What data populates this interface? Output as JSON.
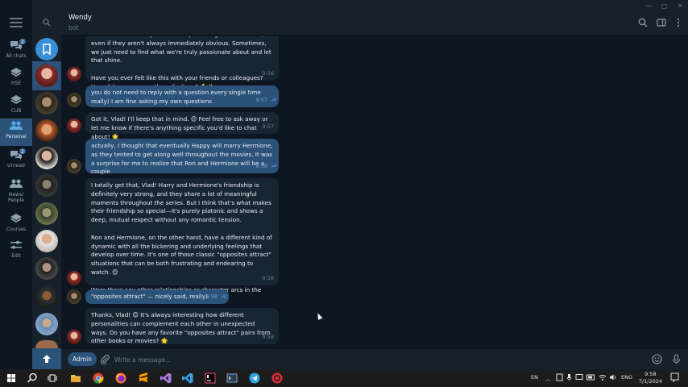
{
  "window": {
    "minimize": "—",
    "maximize": "▢",
    "close": "✕"
  },
  "folders": [
    {
      "label": "All chats",
      "badge": "2",
      "icon": "chat-bubbles-icon"
    },
    {
      "label": "HSE",
      "icon": "layers-icon"
    },
    {
      "label": "CUB",
      "icon": "layers-icon"
    },
    {
      "label": "Personal",
      "icon": "people-icon",
      "active": true
    },
    {
      "label": "Unread",
      "badge": "2",
      "icon": "chat-bubbles-icon"
    },
    {
      "label": "News/\nPeople",
      "icon": "people-icon"
    },
    {
      "label": "Courses",
      "icon": "layers-icon"
    },
    {
      "label": "Edit",
      "icon": "sliders-icon"
    }
  ],
  "header": {
    "name": "Wendy",
    "status": "bot"
  },
  "messages": [
    {
      "dir": "in",
      "text": "remember that everyone has unique strengths and talents, even if they aren't always immediately obvious. Sometimes, we just need to find what we're truly passionate about and let that shine.\n\nHave you ever felt like this with your friends or colleagues? How did you manage those feelings? 💪✨",
      "time": "9:56"
    },
    {
      "dir": "out",
      "text": "you do not need to reply with a question every single time really) I am fine asking my own questions",
      "time": "9:57"
    },
    {
      "dir": "in",
      "text": "Got it, Vlad! I'll keep that in mind. 😊 Feel free to ask away or let me know if there's anything specific you'd like to chat about! 🌟",
      "time": "9:57"
    },
    {
      "dir": "out",
      "text": "actually, I thought that eventually Happy will marry Hermione, as they tented to get along well throughout the movies. It was a surprise for me to realize that Ron and Hermione will be a couple",
      "time": "9:58"
    },
    {
      "dir": "in",
      "text": "I totally get that, Vlad! Harry and Hermione's friendship is definitely very strong, and they share a lot of meaningful moments throughout the series. But I think that's what makes their friendship so special—it's purely platonic and shows a deep, mutual respect without any romantic tension.\n\nRon and Hermione, on the other hand, have a different kind of dynamic with all the bickering and underlying feelings that develop over time. It's one of those classic \"opposites attract\" situations that can be both frustrating and endearing to watch. 😊\n\nWere there any other relationships or character arcs in the series that surprised or intrigued you? 🌟",
      "time": "9:58"
    },
    {
      "dir": "out",
      "text": "\"opposites attract\" — nicely said, really)",
      "time": "9:58"
    },
    {
      "dir": "in",
      "text": "Thanks, Vlad! 😊 It's always interesting how different personalities can complement each other in unexpected ways. Do you have any favorite \"opposites attract\" pairs from other books or movies? 🌟",
      "time": "9:58"
    }
  ],
  "composer": {
    "admin_label": "Admin",
    "placeholder": "Write a message..."
  },
  "taskbar": {
    "lang": "EN",
    "keyboard": "ENG",
    "time": "9:58",
    "date": "7/1/2024",
    "apps": [
      "windows-start-icon",
      "search-icon",
      "task-view-icon",
      "file-explorer-icon",
      "chrome-icon",
      "firefox-icon",
      "sublime-icon",
      "visual-studio-icon",
      "vscode-icon",
      "jetbrains-icon",
      "terminal-icon",
      "telegram-icon",
      "opera-icon"
    ]
  },
  "colors": {
    "background": "#0e1621",
    "panel": "#17212b",
    "incoming": "#182533",
    "outgoing": "#2b5278",
    "accent": "#5288c1"
  }
}
